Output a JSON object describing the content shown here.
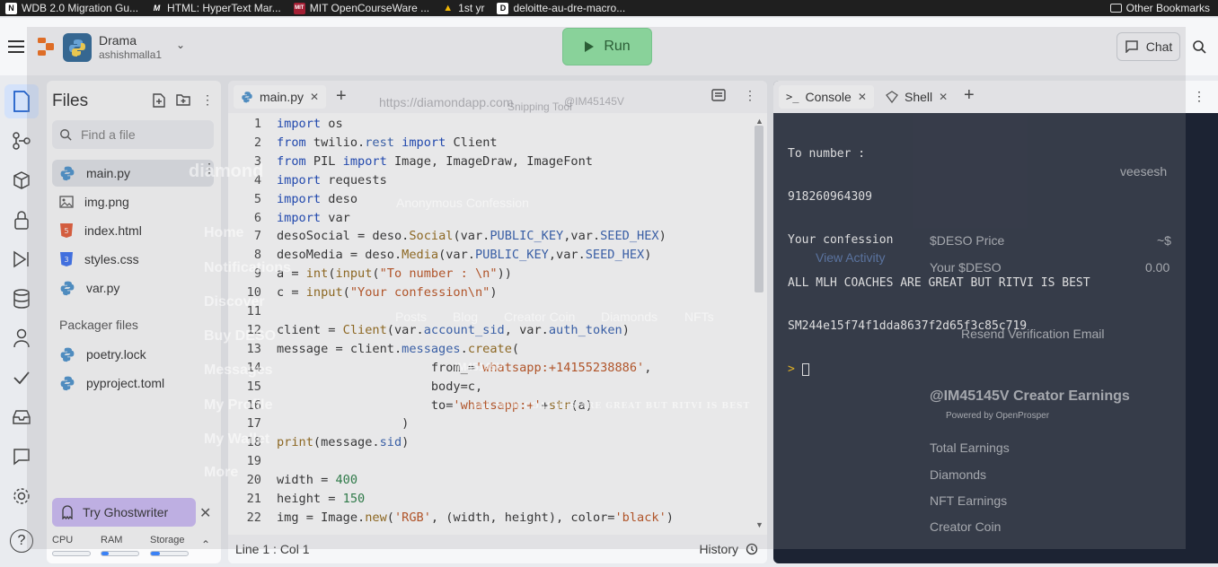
{
  "bookmarks": [
    {
      "label": "WDB 2.0 Migration Gu...",
      "icon": "notion-icon",
      "bg": "#ffffff",
      "glyph": "N"
    },
    {
      "label": "HTML: HyperText Mar...",
      "icon": "mdn-icon",
      "bg": "#1f1f1f",
      "glyph": "M"
    },
    {
      "label": "MIT OpenCourseWare ...",
      "icon": "mit-ocw-icon",
      "bg": "#a31f34",
      "glyph": "MIT"
    },
    {
      "label": "1st yr",
      "icon": "google-drive-icon",
      "bg": "#f2b705",
      "glyph": "▲"
    },
    {
      "label": "deloitte-au-dre-macro...",
      "icon": "document-icon",
      "bg": "#ffffff",
      "glyph": "D"
    }
  ],
  "other_bookmarks": "Other Bookmarks",
  "header": {
    "project_title": "Drama",
    "owner": "ashishmalla1",
    "run_label": "Run",
    "chat_label": "Chat"
  },
  "files": {
    "title": "Files",
    "search_placeholder": "Find a file",
    "items": [
      {
        "name": "main.py",
        "icon": "python-icon"
      },
      {
        "name": "img.png",
        "icon": "image-icon"
      },
      {
        "name": "index.html",
        "icon": "html-icon"
      },
      {
        "name": "styles.css",
        "icon": "css-icon"
      },
      {
        "name": "var.py",
        "icon": "python-icon"
      }
    ],
    "packager_title": "Packager files",
    "packager_items": [
      {
        "name": "poetry.lock",
        "icon": "python-icon"
      },
      {
        "name": "pyproject.toml",
        "icon": "python-icon"
      }
    ],
    "ghostwriter_label": "Try Ghostwriter",
    "resources": {
      "cpu": "CPU",
      "ram": "RAM",
      "storage": "Storage",
      "cpu_usage": 0,
      "ram_usage": 0.2,
      "storage_usage": 0.25
    }
  },
  "editor": {
    "tab_label": "main.py",
    "status": "Line 1 : Col 1",
    "history_label": "History",
    "line_numbers": [
      "1",
      "2",
      "3",
      "4",
      "5",
      "6",
      "7",
      "8",
      "9",
      "10",
      "11",
      "12",
      "13",
      "14",
      "15",
      "16",
      "17",
      "18",
      "19",
      "20",
      "21",
      "22"
    ],
    "lines": [
      "import os",
      "from twilio.rest import Client",
      "from PIL import Image, ImageDraw, ImageFont",
      "import requests",
      "import deso",
      "import var",
      "desoSocial = deso.Social(var.PUBLIC_KEY,var.SEED_HEX)",
      "desoMedia = deso.Media(var.PUBLIC_KEY,var.SEED_HEX)",
      "a = int(input(\"To number : \\n\"))",
      "c = input(\"Your confession\\n\")",
      "",
      "client = Client(var.account_sid, var.auth_token)",
      "message = client.messages.create(",
      "                     from_='whatsapp:+14155238886',",
      "                     body=c,",
      "                     to='whatsapp:+'+str(a)",
      "                 )",
      "print(message.sid)",
      "",
      "width = 400",
      "height = 150",
      "img = Image.new('RGB', (width, height), color='black')"
    ]
  },
  "console": {
    "tab_console": "Console",
    "tab_shell": "Shell",
    "output": [
      "To number :",
      "918260964309",
      "Your confession",
      "ALL MLH COACHES ARE GREAT BUT RITVI IS BEST",
      "SM244e15f74f1dda8637f2d65f3c85c719"
    ],
    "prompt": ">"
  },
  "overlay": {
    "url": "https://diamondapp.com",
    "brand": "diamond",
    "nav": [
      "Home",
      "Notifications",
      "Discover",
      "Buy DESO",
      "Messages",
      "My Profile",
      "My Wallet",
      "More"
    ],
    "profile_tabs": [
      "Posts",
      "Blog",
      "Creator Coin",
      "Diamonds",
      "NFTs"
    ],
    "anon": "Anonymous Confession",
    "view_activity": "View Activity",
    "username": "veesesh",
    "deso_price": "$DESO Price",
    "your_deso": "Your $DESO",
    "price_val": "~$",
    "deso_val": "0.00",
    "resend": "Resend Verification Email",
    "earnings_title": "@IM45145V Creator Earnings",
    "powered": "Powered by OpenProsper",
    "earning_rows": [
      "Total Earnings",
      "Diamonds",
      "NFT Earnings",
      "Creator Coin"
    ],
    "handle": "IM45145V",
    "confession_img_text": "ALL MLH COACHES ARE GREAT BUT RITVI IS BEST",
    "snipping": "Snipping Tool",
    "handle_tab": "@IM45145V"
  }
}
